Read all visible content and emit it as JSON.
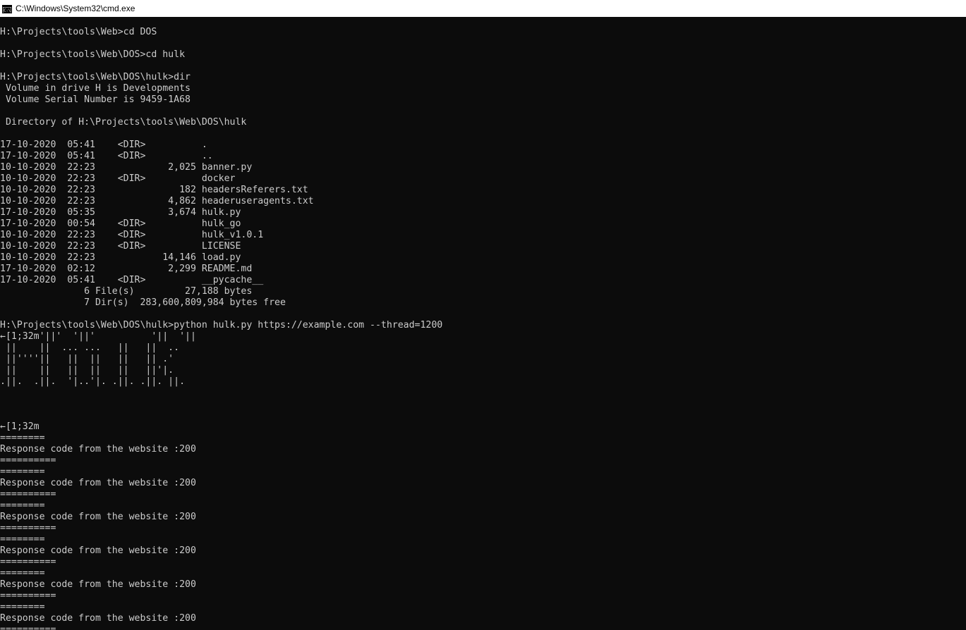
{
  "window": {
    "title": "C:\\Windows\\System32\\cmd.exe",
    "icon": "cmd-icon",
    "colors": {
      "background": "#0c0c0c",
      "foreground": "#cccccc",
      "titlebar": "#ffffff"
    }
  },
  "console": {
    "lines": [
      "H:\\Projects\\tools\\Web>cd DOS",
      "",
      "H:\\Projects\\tools\\Web\\DOS>cd hulk",
      "",
      "H:\\Projects\\tools\\Web\\DOS\\hulk>dir",
      " Volume in drive H is Developments",
      " Volume Serial Number is 9459-1A68",
      "",
      " Directory of H:\\Projects\\tools\\Web\\DOS\\hulk",
      "",
      "17-10-2020  05:41    <DIR>          .",
      "17-10-2020  05:41    <DIR>          ..",
      "10-10-2020  22:23             2,025 banner.py",
      "10-10-2020  22:23    <DIR>          docker",
      "10-10-2020  22:23               182 headersReferers.txt",
      "10-10-2020  22:23             4,862 headeruseragents.txt",
      "17-10-2020  05:35             3,674 hulk.py",
      "17-10-2020  00:54    <DIR>          hulk_go",
      "10-10-2020  22:23    <DIR>          hulk_v1.0.1",
      "10-10-2020  22:23    <DIR>          LICENSE",
      "10-10-2020  22:23            14,146 load.py",
      "17-10-2020  02:12             2,299 README.md",
      "17-10-2020  05:41    <DIR>          __pycache__",
      "               6 File(s)         27,188 bytes",
      "               7 Dir(s)  283,600,809,984 bytes free",
      "",
      "H:\\Projects\\tools\\Web\\DOS\\hulk>python hulk.py https://example.com --thread=1200",
      "←[1;32m'||'  '||'          '||  '||",
      " ||    ||  ... ...   ||   ||  ..",
      " ||''''||   ||  ||   ||   || .'",
      " ||    ||   ||  ||   ||   ||'|.",
      ".||.  .||.  '|..'|. .||. .||. ||.",
      "",
      "",
      "",
      "←[1;32m",
      "========",
      "Response code from the website :200",
      "==========",
      "========",
      "Response code from the website :200",
      "==========",
      "========",
      "Response code from the website :200",
      "==========",
      "========",
      "Response code from the website :200",
      "==========",
      "========",
      "Response code from the website :200",
      "==========",
      "========",
      "Response code from the website :200",
      "=========="
    ]
  }
}
